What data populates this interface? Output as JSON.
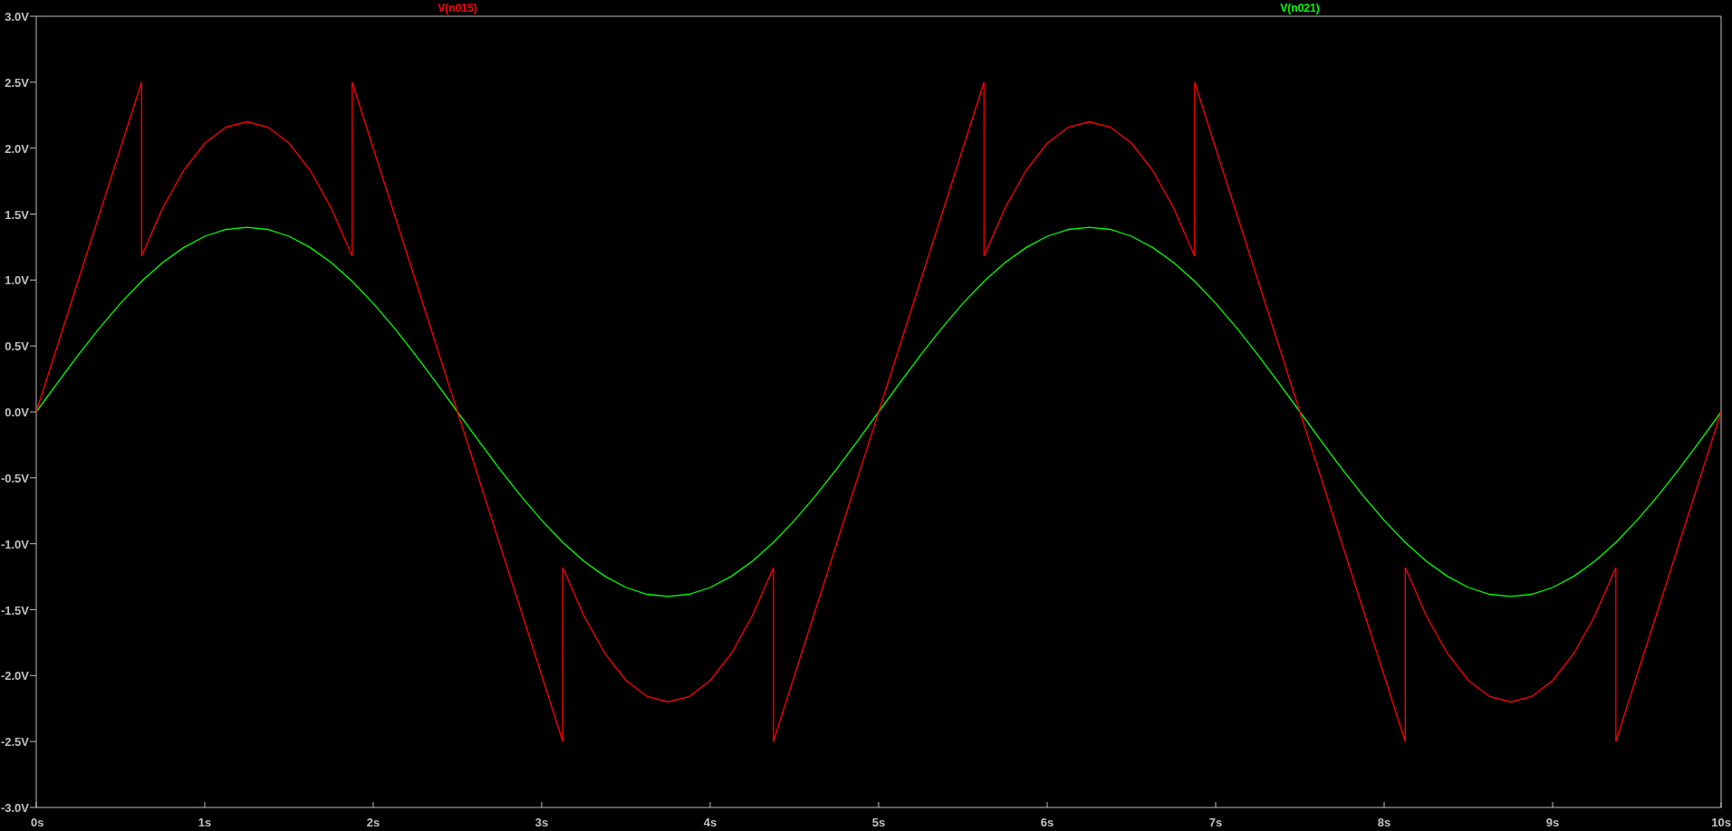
{
  "plot": {
    "chart_data": {
      "type": "line",
      "x": [
        0,
        0.125,
        0.25,
        0.375,
        0.5,
        0.625,
        0.625,
        0.75,
        0.875,
        1,
        1.125,
        1.25,
        1.375,
        1.5,
        1.625,
        1.75,
        1.875,
        1.875,
        2,
        2.125,
        2.25,
        2.375,
        2.5,
        2.625,
        2.75,
        2.875,
        3,
        3.125,
        3.125,
        3.25,
        3.375,
        3.5,
        3.625,
        3.75,
        3.875,
        4,
        4.125,
        4.25,
        4.375,
        4.375,
        4.5,
        4.625,
        4.75,
        4.875,
        5,
        5.125,
        5.25,
        5.375,
        5.5,
        5.625,
        5.625,
        5.75,
        5.875,
        6,
        6.125,
        6.25,
        6.375,
        6.5,
        6.625,
        6.75,
        6.875,
        6.875,
        7,
        7.125,
        7.25,
        7.375,
        7.5,
        7.625,
        7.75,
        7.875,
        8,
        8.125,
        8.125,
        8.25,
        8.375,
        8.5,
        8.625,
        8.75,
        8.875,
        9,
        9.125,
        9.25,
        9.375,
        9.375,
        9.5,
        9.625,
        9.75,
        9.875,
        10
      ],
      "series": [
        {
          "name": "V(n015)",
          "color": "#ff0000",
          "values": [
            0,
            0.5,
            1,
            1.5,
            2,
            2.5,
            1.18,
            1.547,
            1.833,
            2.037,
            2.159,
            2.2,
            2.159,
            2.037,
            1.833,
            1.547,
            1.18,
            2.5,
            2,
            1.5,
            1,
            0.5,
            0,
            -0.5,
            -1,
            -1.5,
            -2,
            -2.5,
            -1.18,
            -1.547,
            -1.833,
            -2.037,
            -2.159,
            -2.2,
            -2.159,
            -2.037,
            -1.833,
            -1.547,
            -1.18,
            -2.5,
            -2,
            -1.5,
            -1,
            -0.5,
            0,
            0.5,
            1,
            1.5,
            2,
            2.5,
            1.18,
            1.547,
            1.833,
            2.037,
            2.159,
            2.2,
            2.159,
            2.037,
            1.833,
            1.547,
            1.18,
            2.5,
            2,
            1.5,
            1,
            0.5,
            0,
            -0.5,
            -1,
            -1.5,
            -2,
            -2.5,
            -1.18,
            -1.547,
            -1.833,
            -2.037,
            -2.159,
            -2.2,
            -2.159,
            -2.037,
            -1.833,
            -1.547,
            -1.18,
            -2.5,
            -2,
            -1.5,
            -1,
            -0.5,
            0
          ]
        },
        {
          "name": "V(n021)",
          "color": "#00ff00",
          "values": [
            0,
            0.219,
            0.433,
            0.636,
            0.823,
            0.99,
            0.99,
            1.133,
            1.247,
            1.332,
            1.383,
            1.4,
            1.383,
            1.332,
            1.247,
            1.133,
            0.99,
            0.99,
            0.823,
            0.636,
            0.433,
            0.219,
            0,
            -0.219,
            -0.433,
            -0.636,
            -0.823,
            -0.99,
            -0.99,
            -1.133,
            -1.247,
            -1.332,
            -1.383,
            -1.4,
            -1.383,
            -1.332,
            -1.247,
            -1.133,
            -0.99,
            -0.99,
            -0.823,
            -0.636,
            -0.433,
            -0.219,
            0,
            0.219,
            0.433,
            0.636,
            0.823,
            0.99,
            0.99,
            1.133,
            1.247,
            1.332,
            1.383,
            1.4,
            1.383,
            1.332,
            1.247,
            1.133,
            0.99,
            0.99,
            0.823,
            0.636,
            0.433,
            0.219,
            0,
            -0.219,
            -0.433,
            -0.636,
            -0.823,
            -0.99,
            -0.99,
            -1.133,
            -1.247,
            -1.332,
            -1.383,
            -1.4,
            -1.383,
            -1.332,
            -1.247,
            -1.133,
            -0.99,
            -0.99,
            -0.823,
            -0.636,
            -0.433,
            -0.219,
            0
          ]
        }
      ],
      "xlim": [
        0,
        10
      ],
      "ylim": [
        -3,
        3
      ],
      "xticks": [
        {
          "value": 0,
          "label": "0s"
        },
        {
          "value": 1,
          "label": "1s"
        },
        {
          "value": 2,
          "label": "2s"
        },
        {
          "value": 3,
          "label": "3s"
        },
        {
          "value": 4,
          "label": "4s"
        },
        {
          "value": 5,
          "label": "5s"
        },
        {
          "value": 6,
          "label": "6s"
        },
        {
          "value": 7,
          "label": "7s"
        },
        {
          "value": 8,
          "label": "8s"
        },
        {
          "value": 9,
          "label": "9s"
        },
        {
          "value": 10,
          "label": "10s"
        }
      ],
      "yticks": [
        {
          "value": 3,
          "label": "3.0V"
        },
        {
          "value": 2.5,
          "label": "2.5V"
        },
        {
          "value": 2,
          "label": "2.0V"
        },
        {
          "value": 1.5,
          "label": "1.5V"
        },
        {
          "value": 1,
          "label": "1.0V"
        },
        {
          "value": 0.5,
          "label": "0.5V"
        },
        {
          "value": 0,
          "label": "0.0V"
        },
        {
          "value": -0.5,
          "label": "-0.5V"
        },
        {
          "value": -1,
          "label": "-1.0V"
        },
        {
          "value": -1.5,
          "label": "-1.5V"
        },
        {
          "value": -2,
          "label": "-2.0V"
        },
        {
          "value": -2.5,
          "label": "-2.5V"
        },
        {
          "value": -3,
          "label": "-3.0V"
        }
      ]
    }
  }
}
